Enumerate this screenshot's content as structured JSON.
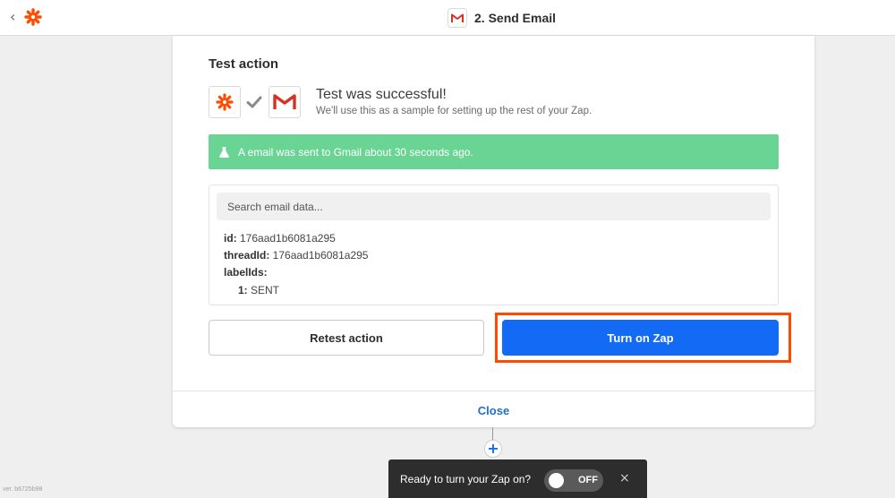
{
  "header": {
    "title": "2. Send Email",
    "back_icon": "chevron-left-icon",
    "logo_icon": "zapier-asterisk-icon",
    "app_icon": "gmail-icon"
  },
  "test_section": {
    "title": "Test action",
    "success_title": "Test was successful!",
    "success_subtitle": "We'll use this as a sample for setting up the rest of your Zap.",
    "alert_text": "A email was sent to Gmail about 30 seconds ago.",
    "alert_icon": "flask-icon"
  },
  "data_panel": {
    "search_placeholder": "Search email data...",
    "rows": [
      {
        "key": "id:",
        "value": " 176aad1b6081a295"
      },
      {
        "key": "threadId:",
        "value": " 176aad1b6081a295"
      },
      {
        "key": "labelIds:",
        "value": ""
      },
      {
        "key": "1:",
        "value": " SENT"
      }
    ]
  },
  "actions": {
    "retest_label": "Retest action",
    "turn_on_label": "Turn on Zap",
    "close_label": "Close"
  },
  "toast": {
    "text": "Ready to turn your Zap on?",
    "toggle_label": "OFF",
    "close_glyph": "×"
  },
  "footer": {
    "version": "ver. b6725b98"
  },
  "colors": {
    "primary_blue": "#136bf5",
    "success_green": "#6ad495",
    "highlight_orange": "#ff4a00",
    "zapier_orange": "#ff4a00",
    "gmail_red": "#d93025"
  }
}
